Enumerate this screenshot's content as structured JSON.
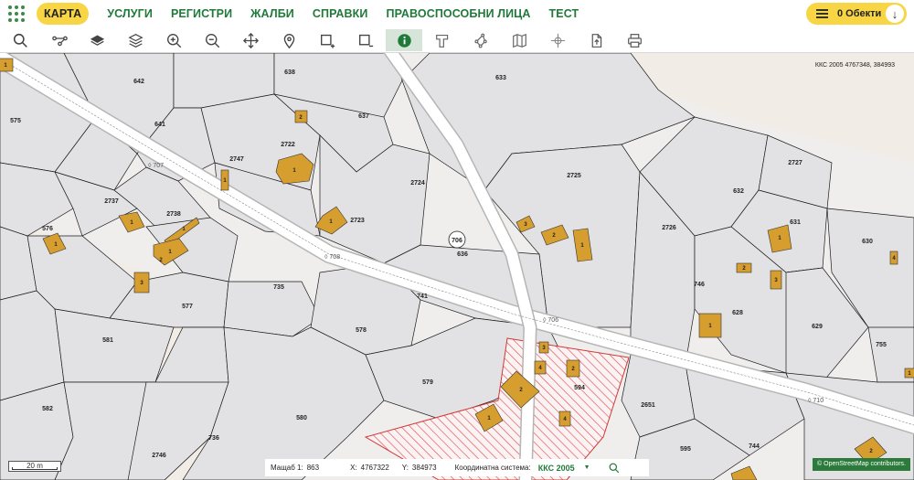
{
  "nav": {
    "items": [
      {
        "label": "КАРТА",
        "active": true
      },
      {
        "label": "УСЛУГИ",
        "active": false
      },
      {
        "label": "РЕГИСТРИ",
        "active": false
      },
      {
        "label": "ЖАЛБИ",
        "active": false
      },
      {
        "label": "СПРАВКИ",
        "active": false
      },
      {
        "label": "ПРАВОСПОСОБНИ ЛИЦА",
        "active": false
      },
      {
        "label": "ТЕСТ",
        "active": false
      }
    ],
    "objects_label": "0 Обекти"
  },
  "toolbar": {
    "tools": [
      "search-icon",
      "route-icon",
      "layers-icon",
      "layers-outline-icon",
      "zoom-in-icon",
      "zoom-out-icon",
      "pan-icon",
      "location-icon",
      "select-add-icon",
      "select-remove-icon",
      "info-icon",
      "measure-area-icon",
      "polygon-icon",
      "map-icon",
      "crosshair-icon",
      "export-icon",
      "print-icon"
    ],
    "active_tool": "info-icon"
  },
  "map": {
    "coords_label": "ККС 2005 4767348, 384993",
    "scale_bar_label": "20 m",
    "parcels": [
      "638",
      "642",
      "575",
      "641",
      "637",
      "633",
      "2722",
      "2747",
      "2725",
      "2727",
      "632",
      "2737",
      "2738",
      "2724",
      "2723",
      "576",
      "631",
      "2726",
      "630",
      "636",
      "746",
      "628",
      "735",
      "741",
      "577",
      "578",
      "629",
      "581",
      "579",
      "594",
      "755",
      "582",
      "580",
      "2651",
      "736",
      "744",
      "2746",
      "595"
    ],
    "road_labels": [
      "707",
      "708",
      "706",
      "710"
    ],
    "circled_label": "706",
    "attribution": "© OpenStreetMap contributors."
  },
  "status": {
    "scale_label": "Мащаб 1:",
    "scale_value": "863",
    "x_label": "X:",
    "x_value": "4767322",
    "y_label": "Y:",
    "y_value": "384973",
    "system_label": "Координатна система:",
    "system_value": "ККС 2005"
  },
  "colors": {
    "accent_green": "#1f7a3a",
    "highlight_yellow": "#f7d544",
    "building": "#d69d2f",
    "parcel_fill": "#e9e9ea",
    "selection_hatch": "#e05050"
  }
}
